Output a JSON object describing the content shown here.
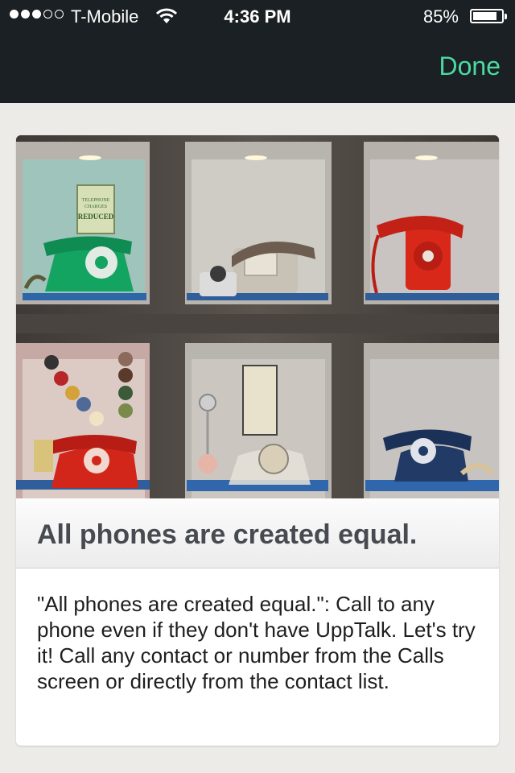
{
  "status_bar": {
    "carrier": "T-Mobile",
    "time": "4:36 PM",
    "battery": "85%",
    "battery_level": 0.85,
    "signal_bars_filled": 3,
    "signal_bars_total": 5
  },
  "nav": {
    "done_label": "Done"
  },
  "card": {
    "image": {
      "sign_text": "TELEPHONE CHARGES REDUCED"
    },
    "title": "All phones are created equal.",
    "body": "\"All phones are created equal.\": Call to any phone even if they don't have UppTalk. Let's try it! Call any contact or number from the Calls screen or directly from the contact list."
  },
  "colors": {
    "bar_background": "#1a2023",
    "accent": "#4cd9a0",
    "page_background": "#ecebe8"
  }
}
